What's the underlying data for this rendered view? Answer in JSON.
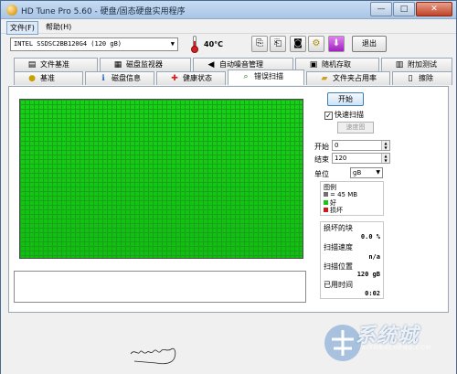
{
  "window": {
    "title": "HD Tune Pro 5.60 - 硬盘/固态硬盘实用程序",
    "controls": {
      "minimize": "—",
      "maximize": "□",
      "close": "✕"
    }
  },
  "menu": {
    "items": [
      {
        "label": "文件(F)"
      },
      {
        "label": "帮助(H)"
      }
    ]
  },
  "toolbar": {
    "drive": "INTEL SSDSC2BB120G4 (120 gB)",
    "temperature": "40°C",
    "exit_label": "退出",
    "buttons": [
      {
        "icon": "copy-info-icon",
        "glyph": "⎘"
      },
      {
        "icon": "copy-text-icon",
        "glyph": "⎗"
      },
      {
        "icon": "camera-icon",
        "glyph": "◙"
      },
      {
        "icon": "options-icon",
        "glyph": "⚙"
      },
      {
        "icon": "download-icon",
        "glyph": "⬇"
      }
    ]
  },
  "tabs": {
    "row1": [
      "文件基准",
      "磁盘监视器",
      "自动噪音管理",
      "随机存取",
      "附加测试"
    ],
    "row2": [
      "基准",
      "磁盘信息",
      "健康状态",
      "错误扫描",
      "文件夹占用率",
      "擦除"
    ],
    "active": "错误扫描"
  },
  "scan": {
    "start_label": "开始",
    "quick_scan_label": "快速扫描",
    "quick_scan_checked": true,
    "speed_map_label": "速度图",
    "start_field_label": "开始",
    "start_value": "0",
    "end_field_label": "结束",
    "end_value": "120",
    "unit_label": "单位",
    "unit_value": "gB",
    "legend_title": "图例",
    "legend": [
      {
        "label": "= 45 MB",
        "color": "#707070"
      },
      {
        "label": "好",
        "color": "#12c812"
      },
      {
        "label": "损坏",
        "color": "#d01818"
      }
    ],
    "stats": {
      "damaged_label": "损坏的块",
      "damaged_value": "0.0 %",
      "speed_label": "扫描速度",
      "speed_value": "n/a",
      "position_label": "扫描位置",
      "position_value": "120 gB",
      "time_label": "已用时间",
      "time_value": "0:02"
    },
    "progress": 1.0
  },
  "watermark": {
    "text": "系统城",
    "sub": "XITONGCHENG.COM"
  },
  "colors": {
    "good_block": "#12c812",
    "grid_line": "#1e9e1e"
  }
}
